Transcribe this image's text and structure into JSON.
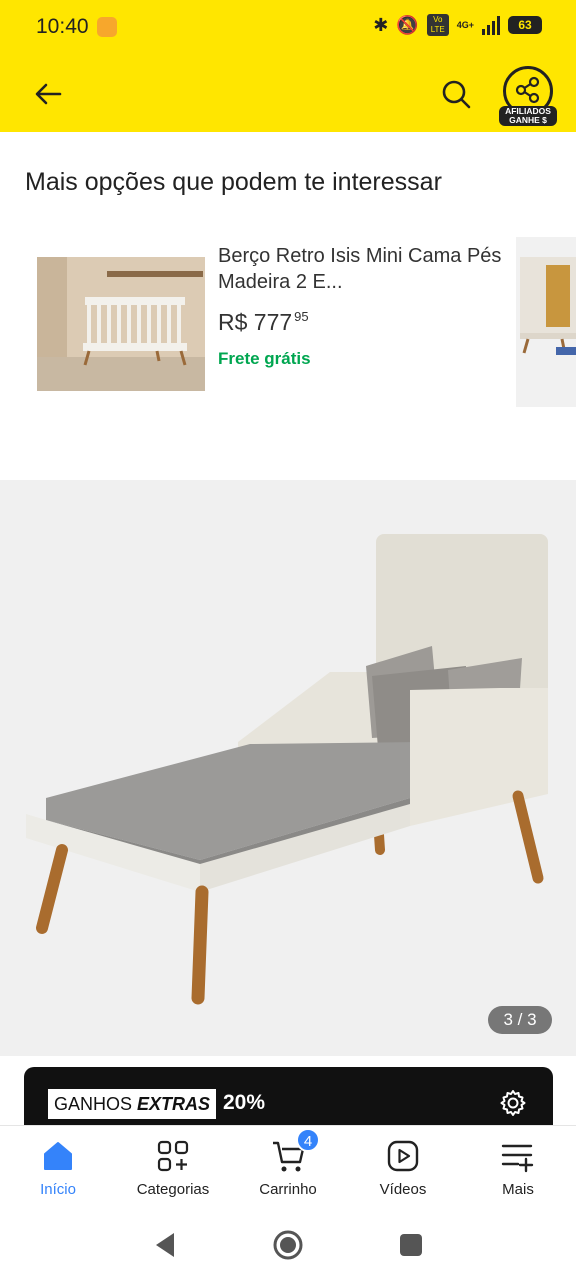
{
  "status_bar": {
    "time": "10:40",
    "volte": "Vo LTE",
    "network": "4G+",
    "battery": "63"
  },
  "app_bar": {
    "back_icon": "arrow-left-icon",
    "search_icon": "search-icon",
    "affiliate_icon": "share-icon",
    "affiliate_label_line1": "AFILIADOS",
    "affiliate_label_line2": "GANHE $",
    "background_color": "#ffe600"
  },
  "recommendations": {
    "heading": "Mais opções que podem te interessar",
    "items": [
      {
        "title": "Berço Retro Isis Mini Cama Pés Madeira 2 E...",
        "price_currency": "R$",
        "price_integer": "777",
        "price_cents": "95",
        "shipping": "Frete grátis"
      }
    ],
    "shipping_color": "#00a650"
  },
  "gallery": {
    "counter": "3 / 3"
  },
  "promo": {
    "tag_prefix": "GANHOS",
    "tag_emphasis": "EXTRAS",
    "percent": "20%",
    "gear_icon": "gear-icon"
  },
  "bottom_nav": {
    "items": [
      {
        "label": "Início",
        "icon": "home-icon",
        "active": true
      },
      {
        "label": "Categorias",
        "icon": "grid-plus-icon",
        "active": false
      },
      {
        "label": "Carrinho",
        "icon": "cart-icon",
        "active": false,
        "badge": "4"
      },
      {
        "label": "Vídeos",
        "icon": "play-icon",
        "active": false
      },
      {
        "label": "Mais",
        "icon": "menu-plus-icon",
        "active": false
      }
    ],
    "active_color": "#3483fa"
  }
}
